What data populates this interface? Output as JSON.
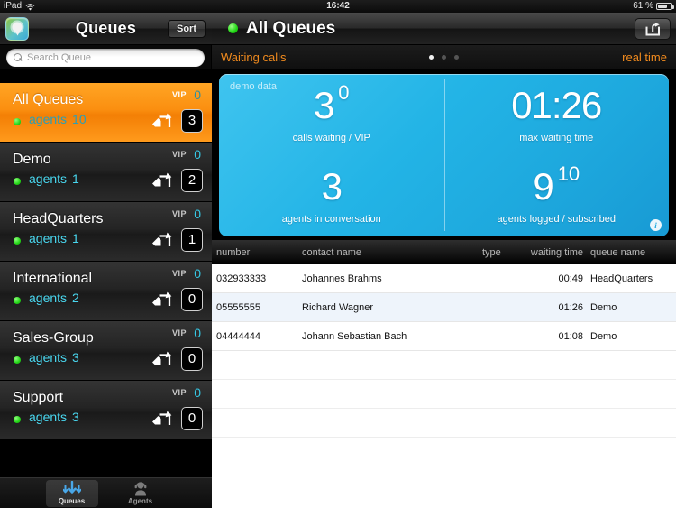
{
  "status_bar": {
    "device": "iPad",
    "wifi_icon": "wifi-icon",
    "time": "16:42",
    "battery_percent": "61 %",
    "battery_icon": "battery-icon"
  },
  "sidebar": {
    "app_icon": "app-logo-icon",
    "title": "Queues",
    "sort_label": "Sort",
    "search": {
      "icon": "search-icon",
      "placeholder": "Search Queue",
      "value": ""
    },
    "vip_label": "VIP",
    "agents_label": "agents",
    "transfer_icon": "transfer-arrow-icon",
    "status_dot_color": "#23d417",
    "selected_row_color": "#fb8f10",
    "agents_text_color": "#49d7ef",
    "items": [
      {
        "name": "All Queues",
        "agents": "10",
        "vip": "0",
        "calls": "3",
        "selected": true
      },
      {
        "name": "Demo",
        "agents": "1",
        "vip": "0",
        "calls": "2",
        "selected": false
      },
      {
        "name": "HeadQuarters",
        "agents": "1",
        "vip": "0",
        "calls": "1",
        "selected": false
      },
      {
        "name": "International",
        "agents": "2",
        "vip": "0",
        "calls": "0",
        "selected": false
      },
      {
        "name": "Sales-Group",
        "agents": "3",
        "vip": "0",
        "calls": "0",
        "selected": false
      },
      {
        "name": "Support",
        "agents": "3",
        "vip": "0",
        "calls": "0",
        "selected": false
      }
    ]
  },
  "tabbar": {
    "tabs": [
      {
        "label": "Queues",
        "icon": "queues-arrows-icon",
        "active": true
      },
      {
        "label": "Agents",
        "icon": "agent-headset-icon",
        "active": false
      }
    ]
  },
  "main": {
    "status_dot_color": "#1fd513",
    "title": "All Queues",
    "share_icon": "share-export-icon",
    "subbar": {
      "left_label": "Waiting calls",
      "right_label": "real time",
      "accent_color": "#f08a1e",
      "page_dots": {
        "count": 3,
        "active_index": 0
      }
    },
    "dashboard": {
      "demo_tag": "demo data",
      "info_icon": "info-icon",
      "background_color": "#23b4e6",
      "cells": [
        {
          "value": "3",
          "sup": "0",
          "label": "calls waiting / VIP"
        },
        {
          "value": "01:26",
          "sup": "",
          "label": "max waiting time"
        },
        {
          "value": "3",
          "sup": "",
          "label": "agents in conversation"
        },
        {
          "value": "9",
          "sup": "10",
          "label": "agents logged / subscribed"
        }
      ]
    },
    "table": {
      "columns": [
        "number",
        "contact name",
        "type",
        "waiting time",
        "queue name"
      ],
      "rows": [
        {
          "number": "032933333",
          "contact": "Johannes Brahms",
          "type": "",
          "wait": "00:49",
          "queue": "HeadQuarters"
        },
        {
          "number": "05555555",
          "contact": "Richard Wagner",
          "type": "",
          "wait": "01:26",
          "queue": "Demo"
        },
        {
          "number": "04444444",
          "contact": "Johann Sebastian Bach",
          "type": "",
          "wait": "01:08",
          "queue": "Demo"
        }
      ],
      "empty_row_count": 4
    }
  }
}
